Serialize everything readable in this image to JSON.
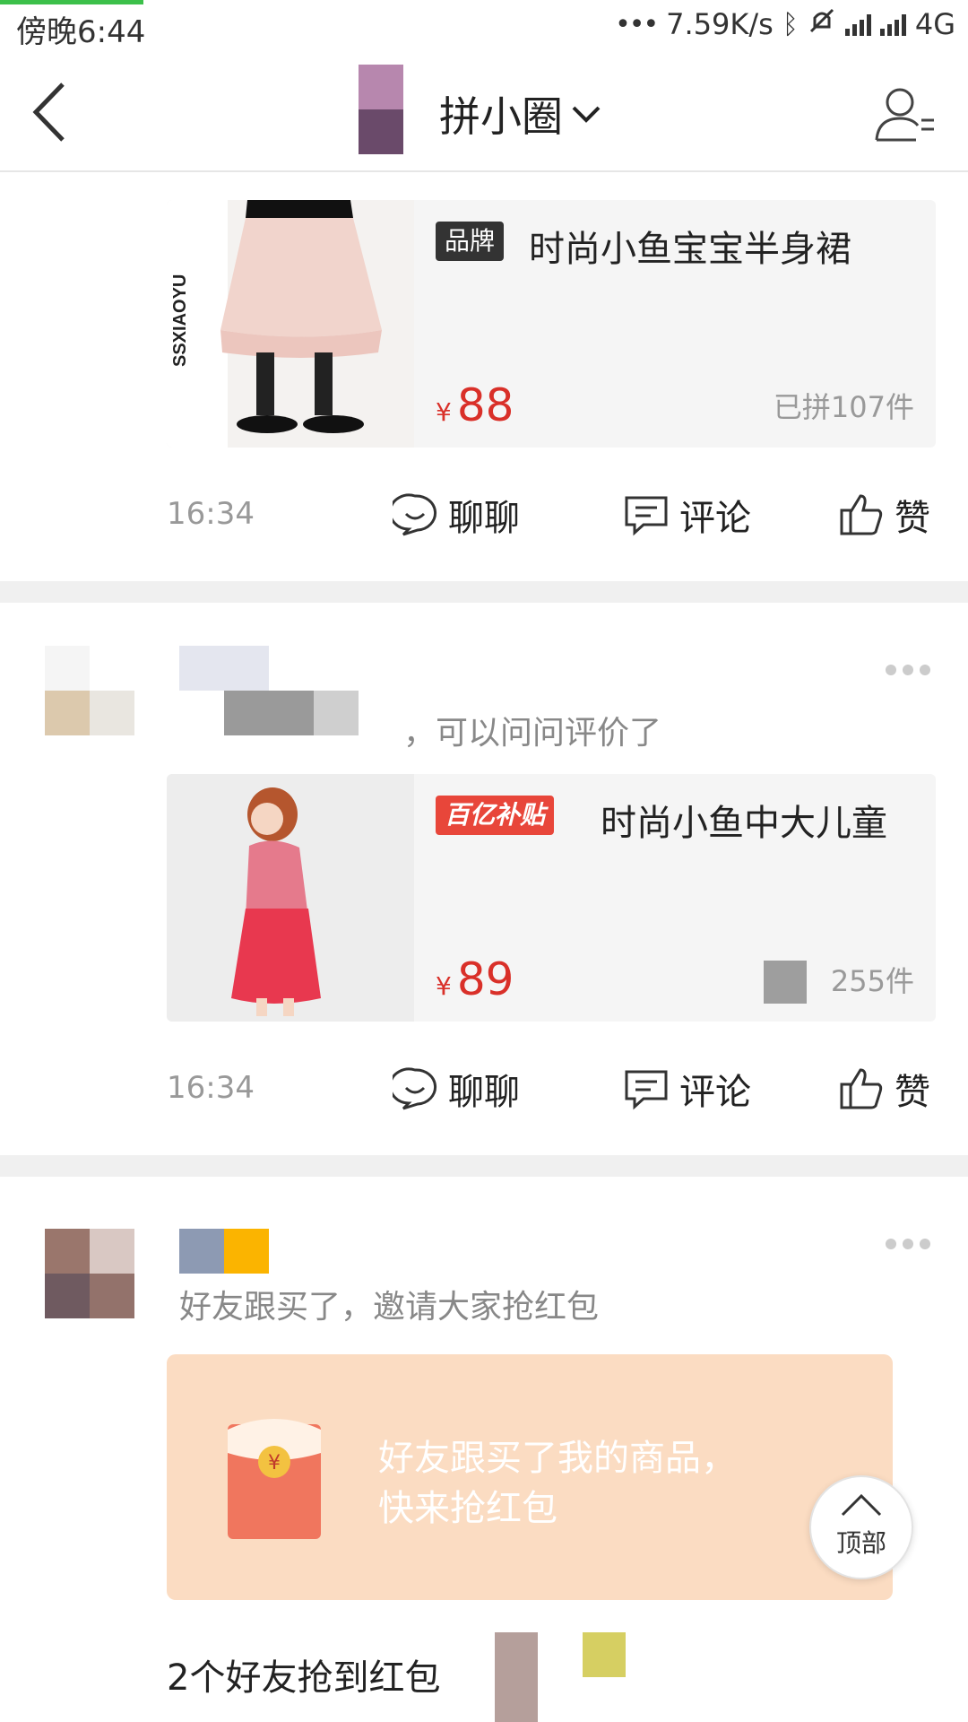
{
  "status_bar": {
    "time": "傍晚6:44",
    "speed": "7.59K/s",
    "network": "4G"
  },
  "header": {
    "title": "拼小圈",
    "back_icon": "chevron-left-icon",
    "dropdown_icon": "chevron-down-icon",
    "profile_icon": "user-list-icon"
  },
  "posts": [
    {
      "product": {
        "tag": "品牌",
        "thumb_text": "SSXIAOYU",
        "title": "时尚小鱼宝宝半身裙",
        "price_symbol": "¥",
        "price": "88",
        "sold": "已拼107件"
      },
      "time": "16:34",
      "actions": {
        "chat": "聊聊",
        "comment": "评论",
        "like": "赞"
      }
    },
    {
      "text": "，可以问问评价了",
      "product": {
        "tag": "百亿补贴",
        "title": "时尚小鱼中大儿童",
        "price_symbol": "¥",
        "price": "89",
        "sold": "255件"
      },
      "time": "16:34",
      "actions": {
        "chat": "聊聊",
        "comment": "评论",
        "like": "赞"
      }
    },
    {
      "text": "好友跟买了，邀请大家抢红包",
      "red_packet": {
        "line1": "好友跟买了我的商品，",
        "line2": "快来抢红包"
      },
      "bottom_text": "2个好友抢到红包"
    }
  ],
  "top_button": {
    "label": "顶部"
  },
  "colors": {
    "price_red": "#d93029",
    "brand_tag_bg": "#333333",
    "subsidy_tag_bg": "#e8463a",
    "red_packet_bg": "#fbdcc2"
  }
}
